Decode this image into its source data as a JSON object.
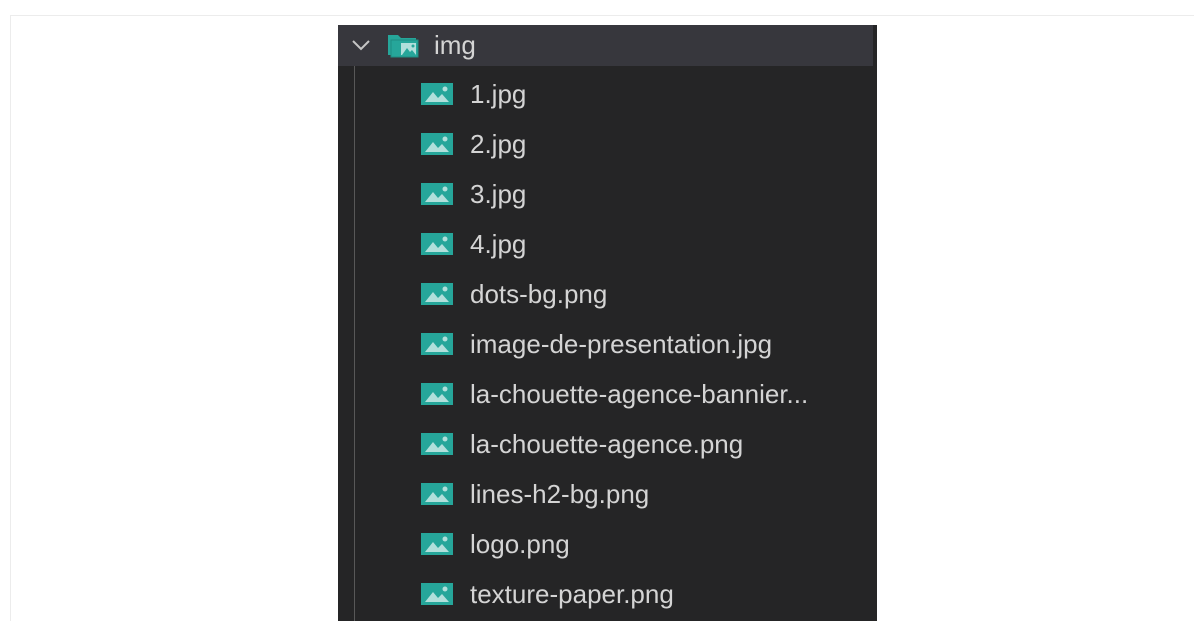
{
  "explorer": {
    "folder": {
      "name": "img",
      "expanded": true,
      "icon": "image-folder-icon"
    },
    "files": [
      {
        "name": "1.jpg",
        "icon": "image-file-icon"
      },
      {
        "name": "2.jpg",
        "icon": "image-file-icon"
      },
      {
        "name": "3.jpg",
        "icon": "image-file-icon"
      },
      {
        "name": "4.jpg",
        "icon": "image-file-icon"
      },
      {
        "name": "dots-bg.png",
        "icon": "image-file-icon"
      },
      {
        "name": "image-de-presentation.jpg",
        "icon": "image-file-icon"
      },
      {
        "name": "la-chouette-agence-bannier...",
        "icon": "image-file-icon"
      },
      {
        "name": "la-chouette-agence.png",
        "icon": "image-file-icon"
      },
      {
        "name": "lines-h2-bg.png",
        "icon": "image-file-icon"
      },
      {
        "name": "logo.png",
        "icon": "image-file-icon"
      },
      {
        "name": "texture-paper.png",
        "icon": "image-file-icon"
      }
    ]
  },
  "colors": {
    "panel_background": "#252526",
    "selected_row": "#37373d",
    "text": "#d4d4d4",
    "icon_accent": "#26a69a",
    "icon_light": "#b2dfdb"
  }
}
